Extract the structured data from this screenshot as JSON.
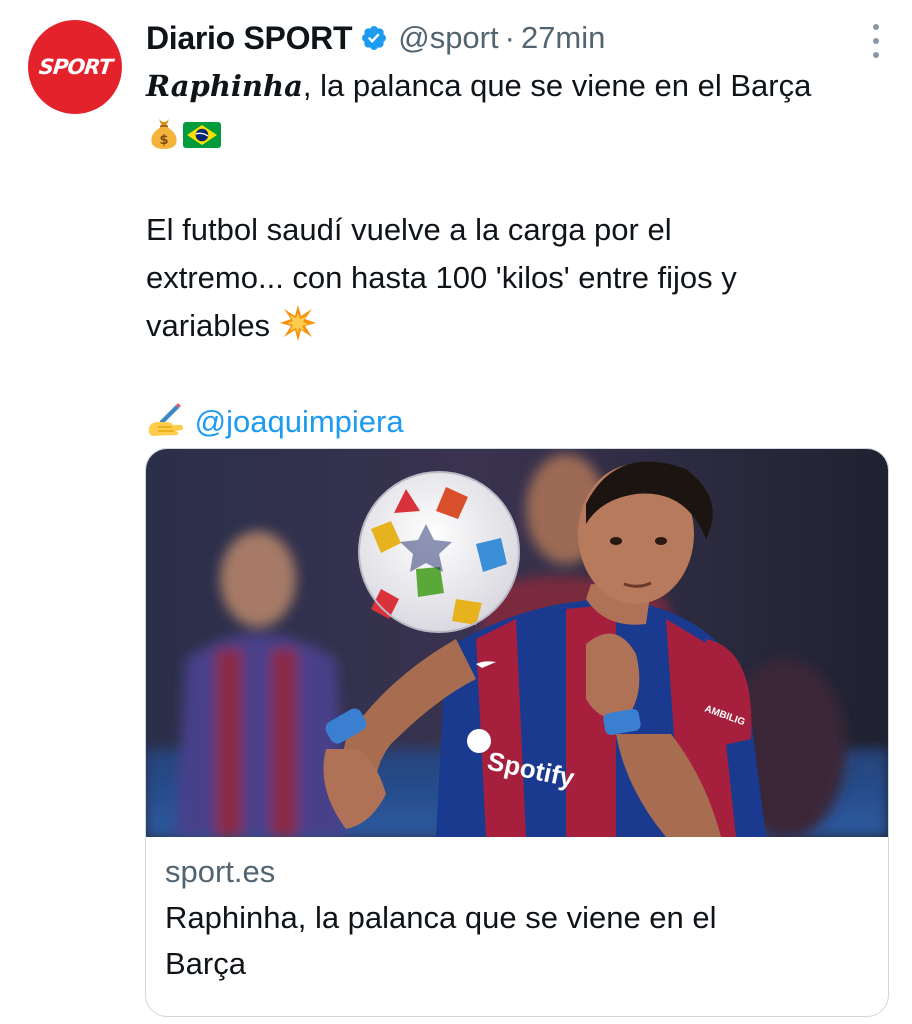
{
  "tweet": {
    "author": {
      "display_name": "Diario SPORT",
      "avatar_text": "SPORT",
      "verified_icon": "verified-badge-icon",
      "handle": "@sport",
      "separator": "·",
      "time": "27min"
    },
    "more_icon": "more-vertical-icon",
    "text": {
      "lead_name": "Raphinha",
      "lead_rest": ", la palanca que se viene en el Barça",
      "line2_emojis": [
        "money-bag-icon",
        "brazil-flag-icon"
      ],
      "para2_line1": "El futbol saudí vuelve a la carga por el",
      "para2_line2": "extremo... con hasta 100 'kilos' entre fijos y",
      "para2_line3": "variables",
      "para2_emoji": "collision-icon",
      "author_emoji": "writing-hand-icon",
      "mention": "@joaquimpiera"
    },
    "card": {
      "image_subject": "footballer-with-ball-photo",
      "jersey_sponsor": "Spotify",
      "jersey_sleeve": "AMBILIG",
      "domain": "sport.es",
      "title_line1": "Raphinha, la palanca que se viene en el",
      "title_line2": "Barça"
    }
  },
  "colors": {
    "brand_red": "#e4222b",
    "link_blue": "#1d9bf0",
    "secondary_text": "#536471",
    "border": "#cfd9de",
    "barca_blue": "#1a3a8f",
    "barca_red": "#a6203d"
  }
}
